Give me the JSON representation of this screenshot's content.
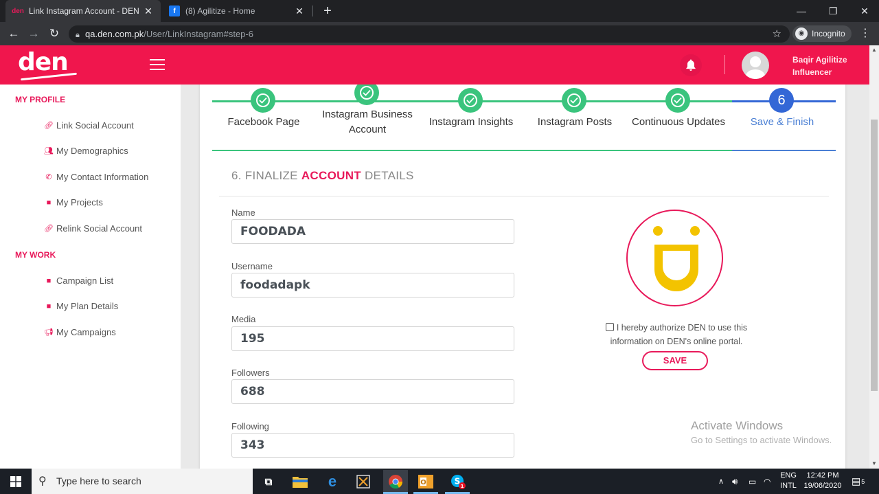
{
  "browser": {
    "tabs": [
      {
        "title": "Link Instagram Account - DEN",
        "active": true
      },
      {
        "title": "(8) Agilitize - Home",
        "active": false
      }
    ],
    "address": {
      "host": "qa.den.com.pk",
      "path": "/User/LinkInstagram#step-6"
    },
    "incognito_label": "Incognito"
  },
  "header": {
    "logo_text": "den",
    "user_name": "Baqir Agilitize",
    "user_role": "Influencer"
  },
  "sidebar": {
    "sections": [
      {
        "heading": "MY PROFILE",
        "items": [
          {
            "label": "Link Social Account",
            "icon": "link-icon"
          },
          {
            "label": "My Demographics",
            "icon": "users-icon"
          },
          {
            "label": "My Contact Information",
            "icon": "phone-icon"
          },
          {
            "label": "My Projects",
            "icon": "briefcase-icon"
          },
          {
            "label": "Relink Social Account",
            "icon": "link-icon"
          }
        ]
      },
      {
        "heading": "MY WORK",
        "items": [
          {
            "label": "Campaign List",
            "icon": "briefcase-icon"
          },
          {
            "label": "My Plan Details",
            "icon": "briefcase-icon"
          },
          {
            "label": "My Campaigns",
            "icon": "bullhorn-icon"
          }
        ]
      }
    ]
  },
  "stepper": {
    "steps": [
      {
        "label": "Facebook Page",
        "state": "done"
      },
      {
        "label": "Instagram Business Account",
        "state": "done"
      },
      {
        "label": "Instagram Insights",
        "state": "done"
      },
      {
        "label": "Instagram Posts",
        "state": "done"
      },
      {
        "label": "Continuous Updates",
        "state": "done"
      },
      {
        "label": "Save & Finish",
        "state": "active",
        "number": "6"
      }
    ],
    "colors": {
      "done": "#3ac47d",
      "active": "#3367d6"
    }
  },
  "form": {
    "title_prefix": "6. FINALIZE ",
    "title_highlight": "ACCOUNT",
    "title_suffix": " DETAILS",
    "fields": [
      {
        "label": "Name",
        "value": "FOODADA"
      },
      {
        "label": "Username",
        "value": "foodadapk"
      },
      {
        "label": "Media",
        "value": "195"
      },
      {
        "label": "Followers",
        "value": "688"
      },
      {
        "label": "Following",
        "value": "343"
      }
    ],
    "authorize_text": "I hereby authorize DEN to use this information on DEN's online portal.",
    "save_label": "SAVE"
  },
  "watermark": {
    "line1": "Activate Windows",
    "line2": "Go to Settings to activate Windows."
  },
  "taskbar": {
    "search_placeholder": "Type here to search",
    "lang_line1": "ENG",
    "lang_line2": "INTL",
    "time": "12:42 PM",
    "date": "19/06/2020",
    "notification_count": "5"
  },
  "colors": {
    "brand": "#f0164d",
    "accent": "#e8195a",
    "success": "#3ac47d",
    "active_step": "#3367d6"
  }
}
